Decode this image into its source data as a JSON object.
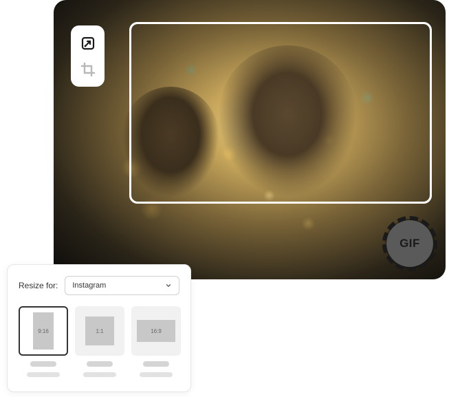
{
  "canvas": {
    "gif_badge_label": "GIF"
  },
  "toolbox": {
    "resize_icon": "resize-icon",
    "crop_icon": "crop-icon"
  },
  "resize_panel": {
    "label": "Resize for:",
    "selected_platform": "Instagram",
    "ratios": [
      {
        "label": "9:16",
        "selected": true
      },
      {
        "label": "1:1",
        "selected": false
      },
      {
        "label": "16:9",
        "selected": false
      }
    ]
  }
}
